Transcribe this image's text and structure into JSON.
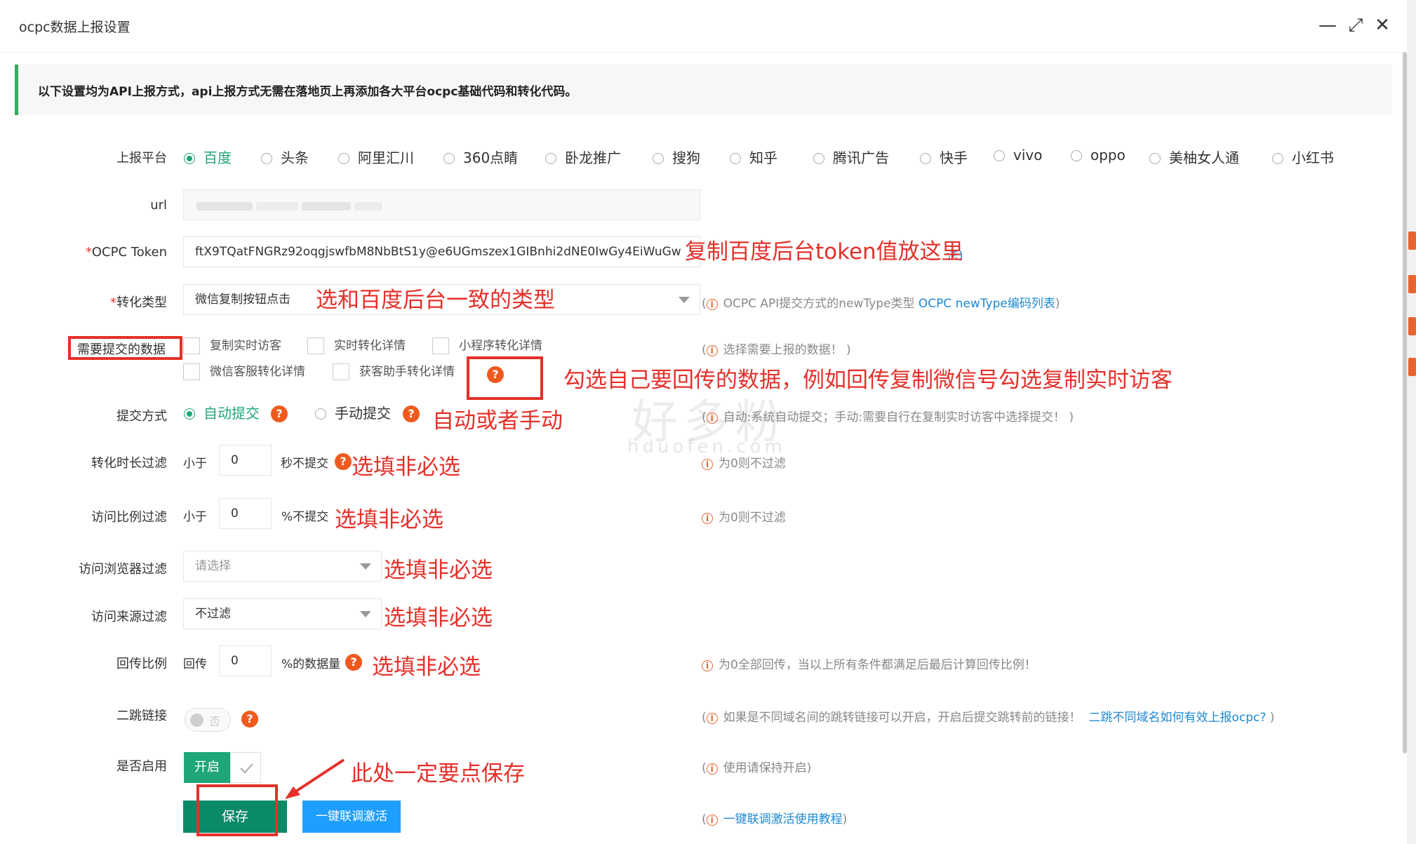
{
  "window": {
    "title": "ocpc数据上报设置",
    "minimize": "—",
    "maximize": "⤢",
    "close": "✕"
  },
  "notice": "以下设置均为API上报方式，api上报方式无需在落地页上再添加各大平台ocpc基础代码和转化代码。",
  "platform": {
    "label": "上报平台",
    "options": [
      "百度",
      "头条",
      "阿里汇川",
      "360点睛",
      "卧龙推广",
      "搜狗",
      "知乎",
      "腾讯广告",
      "快手",
      "vivo",
      "oppo",
      "美柚女人通",
      "小红书"
    ],
    "selected": "百度"
  },
  "url": {
    "label": "url",
    "value": ""
  },
  "token": {
    "label": "OCPC Token",
    "required_mark": "*",
    "value": "ftX9TQatFNGRz92oqgjswfbM8NbBtS1y@e6UGmszex1GIBnhi2dNE0IwGy4EiWuGw",
    "hint_link": "法)"
  },
  "conversion_type": {
    "label": "转化类型",
    "required_mark": "*",
    "value": "微信复制按钮点击",
    "hint_text": "OCPC API提交方式的newType类型",
    "hint_link": "OCPC newType编码列表"
  },
  "submit_data": {
    "label": "需要提交的数据",
    "options": [
      "复制实时访客",
      "实时转化详情",
      "小程序转化详情",
      "微信客服转化详情",
      "获客助手转化详情"
    ],
    "hint": "选择需要上报的数据！"
  },
  "submit_mode": {
    "label": "提交方式",
    "options": [
      "自动提交",
      "手动提交"
    ],
    "selected": "自动提交",
    "hint": "自动:系统自动提交；手动:需要自行在复制实时访客中选择提交！"
  },
  "duration_filter": {
    "label": "转化时长过滤",
    "prefix": "小于",
    "value": "0",
    "suffix": "秒不提交",
    "hint": "为0则不过滤"
  },
  "ratio_filter": {
    "label": "访问比例过滤",
    "prefix": "小于",
    "value": "0",
    "suffix": "%不提交",
    "hint": "为0则不过滤"
  },
  "browser_filter": {
    "label": "访问浏览器过滤",
    "placeholder": "请选择"
  },
  "source_filter": {
    "label": "访问来源过滤",
    "value": "不过滤"
  },
  "callback_ratio": {
    "label": "回传比例",
    "prefix": "回传",
    "value": "0",
    "suffix": "%的数据量",
    "hint": "为0全部回传，当以上所有条件都满足后最后计算回传比例！"
  },
  "second_jump": {
    "label": "二跳链接",
    "toggle_text": "否",
    "hint_text": "如果是不同域名间的跳转链接可以开启，开启后提交跳转前的链接！",
    "hint_link": "二跳不同域名如何有效上报ocpc?"
  },
  "enabled": {
    "label": "是否启用",
    "on_text": "开启",
    "hint": "使用请保持开启)"
  },
  "buttons": {
    "save": "保存",
    "link_activate": "一键联调激活",
    "tutorial_link": "一键联调激活使用教程"
  },
  "help_mark": "?",
  "info_mark": "i",
  "watermark": {
    "cn": "好多粉",
    "en": "hduofen.com"
  },
  "annotations": {
    "token": "复制百度后台token值放这里",
    "type": "选和百度后台一致的类型",
    "data": "勾选自己要回传的数据，例如回传复制微信号勾选复制实时访客",
    "mode": "自动或者手动",
    "optional": "选填非必选",
    "save": "此处一定要点保存"
  },
  "colors": {
    "accent_green": "#1fa67a",
    "save_green": "#0b8a6a",
    "blue": "#1e9fff",
    "annotation_red": "#e5302a",
    "help_orange": "#f05a1e"
  }
}
